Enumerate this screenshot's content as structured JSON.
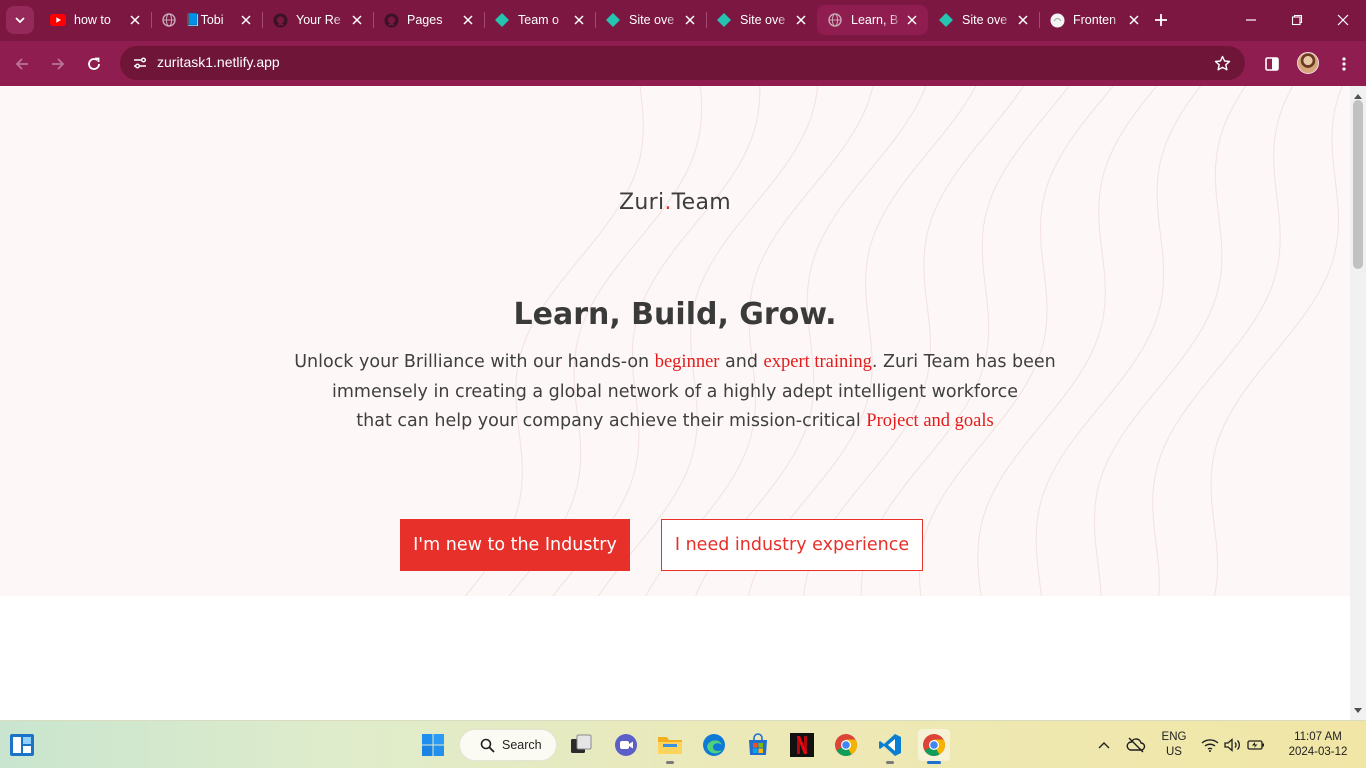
{
  "colors": {
    "tab_strip": "#7b1740",
    "toolbar": "#8f1d4f",
    "omnibox": "#6e1538",
    "hero_background": "#fdf8f7",
    "accent_red": "#e8302a",
    "text_dark": "#3a3a3a"
  },
  "browser": {
    "tabs": [
      {
        "title": "how to",
        "icon": "youtube-icon",
        "active": false
      },
      {
        "title": "📘Tobi",
        "icon": "globe-icon",
        "active": false
      },
      {
        "title": "Your Re",
        "icon": "github-icon",
        "active": false
      },
      {
        "title": "Pages",
        "icon": "github-icon",
        "active": false
      },
      {
        "title": "Team o",
        "icon": "netlify-icon",
        "active": false
      },
      {
        "title": "Site ove",
        "icon": "netlify-icon",
        "active": false
      },
      {
        "title": "Site ove",
        "icon": "netlify-icon",
        "active": false
      },
      {
        "title": "Learn, B",
        "icon": "globe-icon",
        "active": true
      },
      {
        "title": "Site ove",
        "icon": "netlify-icon",
        "active": false
      },
      {
        "title": "Fronten",
        "icon": "globe-icon",
        "active": false
      }
    ],
    "address": {
      "url": "zuritask1.netlify.app"
    }
  },
  "page": {
    "logo": {
      "part1": "Zuri",
      "dot": ".",
      "part2": "Team"
    },
    "headline": "Learn, Build, Grow.",
    "lead": {
      "t1": "Unlock your Brilliance with our hands-on ",
      "h1": "beginner",
      "t2": " and ",
      "h2": "expert training",
      "t3": ". Zuri Team has been",
      "t4": "immensely in creating a global network of a highly adept intelligent workforce",
      "t5": "that can help your company achieve their mission-critical ",
      "h3": "Project and goals"
    },
    "buttons": {
      "primary": "I'm new to the Industry",
      "secondary": "I need industry experience"
    }
  },
  "taskbar": {
    "search_label": "Search",
    "apps": [
      "windows-start-icon",
      "task-view-icon",
      "meet-icon",
      "file-explorer-icon",
      "edge-icon",
      "microsoft-store-icon",
      "netflix-icon",
      "chrome-icon",
      "vscode-icon",
      "chrome-profile-icon"
    ],
    "tray": {
      "lang_top": "ENG",
      "lang_bottom": "US",
      "time": "11:07 AM",
      "date": "2024-03-12"
    }
  }
}
